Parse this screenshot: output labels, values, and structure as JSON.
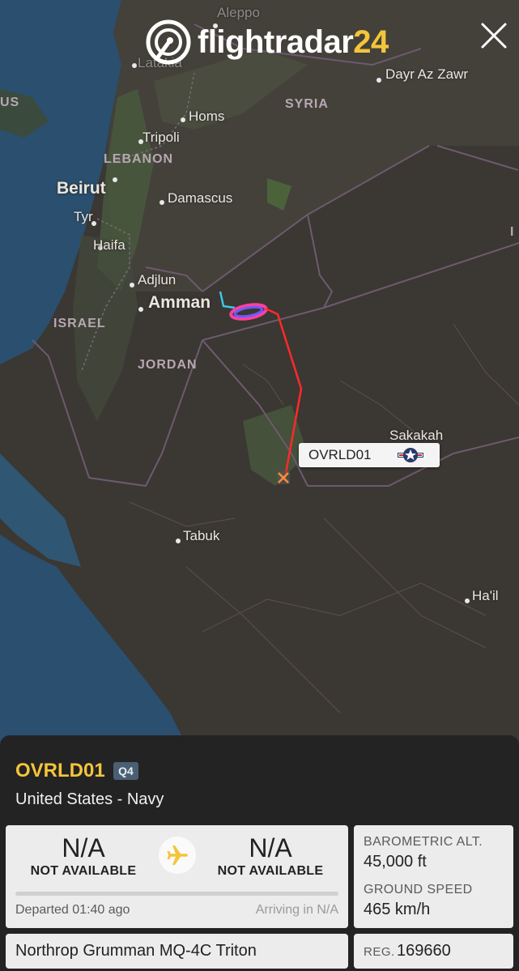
{
  "brand": {
    "name_main": "flightradar",
    "name_num": "24",
    "accent_color": "#f3c53b"
  },
  "map": {
    "cities": {
      "aleppo": "Aleppo",
      "latakia": "Latakia",
      "homs": "Homs",
      "tripoli": "Tripoli",
      "dayr_az_zawr": "Dayr Az Zawr",
      "beirut": "Beirut",
      "damascus": "Damascus",
      "tyr": "Tyr",
      "haifa": "Haifa",
      "adjlun": "Adjlun",
      "amman": "Amman",
      "sakakah": "Sakakah",
      "tabuk": "Tabuk",
      "hail": "Ha'il"
    },
    "countries": {
      "syria": "SYRIA",
      "lebanon": "LEBANON",
      "israel": "ISRAEL",
      "jordan": "JORDAN",
      "us_partial": "US",
      "iraq_partial": "I"
    },
    "track_colors": [
      "#ff2a2a",
      "#3cc6e8",
      "#6a5cff",
      "#ff3fa0"
    ]
  },
  "callout": {
    "callsign": "OVRLD01"
  },
  "flight": {
    "callsign": "OVRLD01",
    "badge": "Q4",
    "operator": "United States - Navy",
    "origin": {
      "code": "N/A",
      "name": "NOT AVAILABLE"
    },
    "destination": {
      "code": "N/A",
      "name": "NOT AVAILABLE"
    },
    "progress_fraction": 0,
    "departed": "Departed 01:40 ago",
    "arriving": "Arriving in N/A",
    "baro_alt_label": "BAROMETRIC ALT.",
    "baro_alt_value": "45,000 ft",
    "ground_speed_label": "GROUND SPEED",
    "ground_speed_value": "465 km/h",
    "aircraft_type": "Northrop Grumman MQ-4C Triton",
    "reg_label": "REG.",
    "reg_value": "169660"
  }
}
